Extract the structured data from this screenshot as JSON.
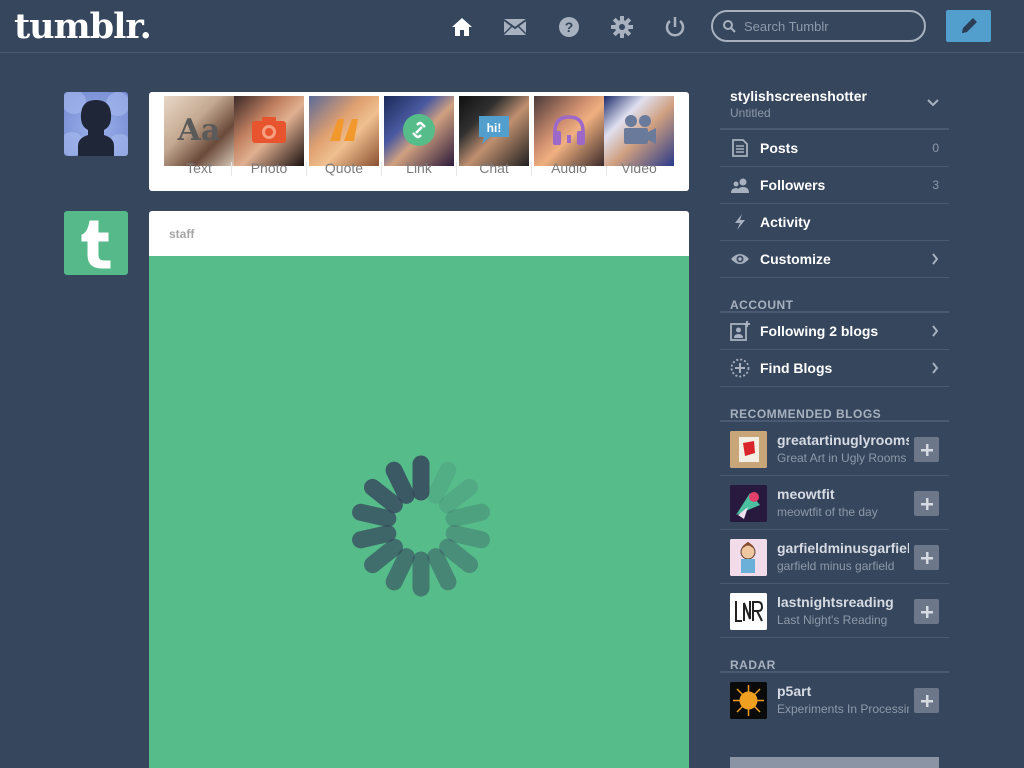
{
  "header": {
    "logo": "tumblr.",
    "search_placeholder": "Search Tumblr",
    "icons": [
      "home-icon",
      "mail-icon",
      "help-icon",
      "gear-icon",
      "power-icon"
    ],
    "compose_icon": "pencil-icon"
  },
  "post_types": [
    {
      "label": "Text",
      "icon": "Aa"
    },
    {
      "label": "Photo",
      "icon": "camera-icon"
    },
    {
      "label": "Quote",
      "icon": "quote-icon"
    },
    {
      "label": "Link",
      "icon": "link-icon"
    },
    {
      "label": "Chat",
      "icon": "hi!"
    },
    {
      "label": "Audio",
      "icon": "headphones-icon"
    },
    {
      "label": "Video",
      "icon": "video-camera-icon"
    }
  ],
  "post": {
    "author": "staff"
  },
  "sidebar": {
    "blog": {
      "name": "stylishscreenshotter",
      "subtitle": "Untitled"
    },
    "items": [
      {
        "label": "Posts",
        "count": "0"
      },
      {
        "label": "Followers",
        "count": "3"
      },
      {
        "label": "Activity",
        "count": ""
      },
      {
        "label": "Customize",
        "count": ""
      }
    ],
    "account_title": "ACCOUNT",
    "account_items": [
      {
        "label": "Following 2 blogs"
      },
      {
        "label": "Find Blogs"
      }
    ],
    "recommended_title": "RECOMMENDED BLOGS",
    "recommended": [
      {
        "name": "greatartinuglyrooms",
        "desc": "Great Art in Ugly Rooms"
      },
      {
        "name": "meowtfit",
        "desc": "meowtfit of the day"
      },
      {
        "name": "garfieldminusgarfield",
        "desc": "garfield minus garfield"
      },
      {
        "name": "lastnightsreading",
        "desc": "Last Night's Reading"
      }
    ],
    "radar_title": "RADAR",
    "radar": {
      "name": "p5art",
      "desc": "Experiments In Processing"
    }
  },
  "colors": {
    "background": "#36465d",
    "accent": "#529ecc",
    "staff_green": "#56bc8a"
  }
}
